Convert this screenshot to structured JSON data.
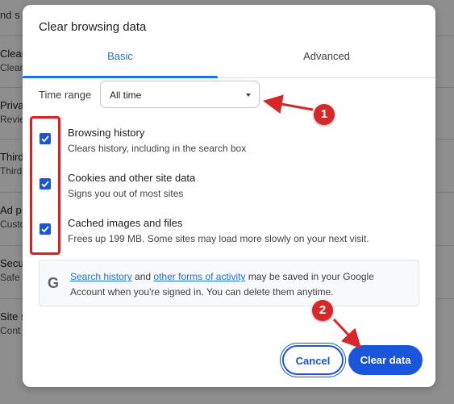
{
  "background": {
    "header_fragment": "nd s",
    "rows": [
      {
        "title": "Clear",
        "sub": "Clear"
      },
      {
        "title": "Priva",
        "sub": "Revie"
      },
      {
        "title": "Third",
        "sub": "Third"
      },
      {
        "title": "Ad p",
        "sub": "Custo"
      },
      {
        "title": "Secu",
        "sub": "Safe"
      },
      {
        "title": "Site s",
        "sub": "Cont"
      }
    ]
  },
  "dialog": {
    "title": "Clear browsing data",
    "tabs": [
      {
        "label": "Basic",
        "active": true
      },
      {
        "label": "Advanced",
        "active": false
      }
    ],
    "time_range": {
      "label": "Time range",
      "value": "All time"
    },
    "options": [
      {
        "label": "Browsing history",
        "sub": "Clears history, including in the search box",
        "checked": true
      },
      {
        "label": "Cookies and other site data",
        "sub": "Signs you out of most sites",
        "checked": true
      },
      {
        "label": "Cached images and files",
        "sub": "Frees up 199 MB. Some sites may load more slowly on your next visit.",
        "checked": true
      }
    ],
    "info": {
      "link1": "Search history",
      "mid1": "and",
      "link2": "other forms of activity",
      "rest": "may be saved in your Google Account when you're signed in. You can delete them anytime.",
      "icon": "google-g-icon"
    },
    "buttons": {
      "cancel": "Cancel",
      "clear": "Clear data"
    }
  },
  "annotations": {
    "badge1": "1",
    "badge2": "2",
    "color": "#d62828"
  }
}
